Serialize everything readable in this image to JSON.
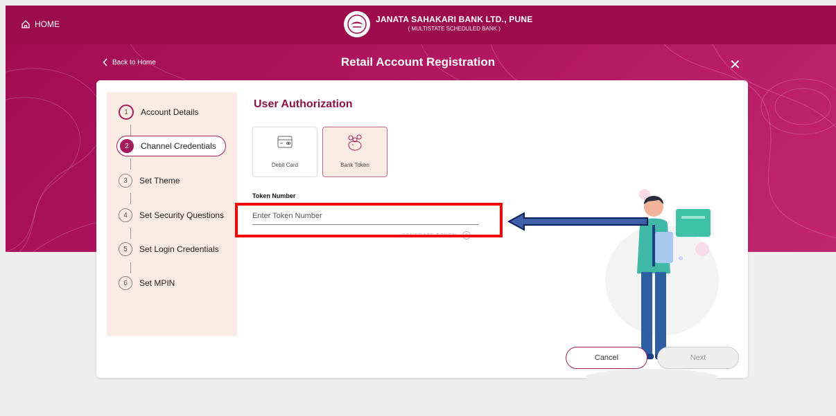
{
  "header": {
    "home_label": "HOME",
    "bank_name": "JANATA SAHAKARI BANK LTD., PUNE",
    "bank_subtitle": "( MULTISTATE SCHEDULED BANK )"
  },
  "subheader": {
    "back_label": "Back to Home",
    "title": "Retail Account Registration"
  },
  "steps": [
    {
      "num": "1",
      "label": "Account Details",
      "status": "completed"
    },
    {
      "num": "2",
      "label": "Channel Credentials",
      "status": "current"
    },
    {
      "num": "3",
      "label": "Set Theme",
      "status": "pending"
    },
    {
      "num": "4",
      "label": "Set Security Questions",
      "status": "pending"
    },
    {
      "num": "5",
      "label": "Set Login Credentials",
      "status": "pending"
    },
    {
      "num": "6",
      "label": "Set MPIN",
      "status": "pending"
    }
  ],
  "form": {
    "section_title": "User Authorization",
    "options": [
      {
        "label": "Debit Card",
        "icon": "debit-card-icon",
        "selected": false
      },
      {
        "label": "Bank Token",
        "icon": "bank-token-icon",
        "selected": true
      }
    ],
    "token_label": "Token Number",
    "token_placeholder": "Enter Token Number",
    "token_value": "",
    "generate_token_label": "GENERATE TOKEN",
    "help_glyph": "?"
  },
  "buttons": {
    "cancel": "Cancel",
    "next": "Next"
  },
  "colors": {
    "brand": "#9c0b4b",
    "accent": "#a51a5a",
    "stepper_bg": "#fbece3",
    "highlight": "#ff0000",
    "arrow": "#3c5fa8"
  }
}
